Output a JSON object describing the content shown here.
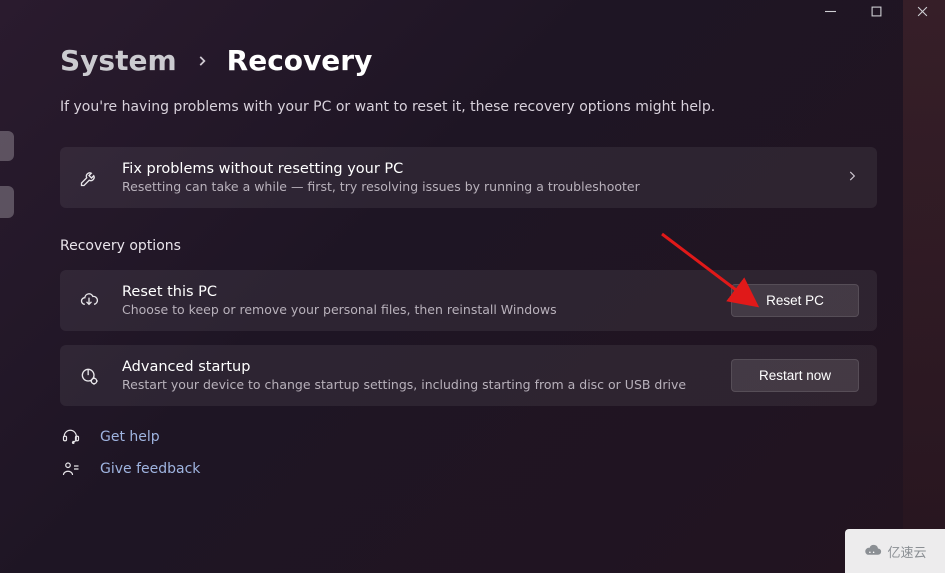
{
  "breadcrumb": {
    "parent": "System",
    "page": "Recovery"
  },
  "intro": "If you're having problems with your PC or want to reset it, these recovery options might help.",
  "fix": {
    "title": "Fix problems without resetting your PC",
    "sub": "Resetting can take a while — first, try resolving issues by running a troubleshooter"
  },
  "section_title": "Recovery options",
  "reset": {
    "title": "Reset this PC",
    "sub": "Choose to keep or remove your personal files, then reinstall Windows",
    "button": "Reset PC"
  },
  "advanced": {
    "title": "Advanced startup",
    "sub": "Restart your device to change startup settings, including starting from a disc or USB drive",
    "button": "Restart now"
  },
  "get_help": "Get help",
  "give_feedback": "Give feedback",
  "watermark": "亿速云"
}
